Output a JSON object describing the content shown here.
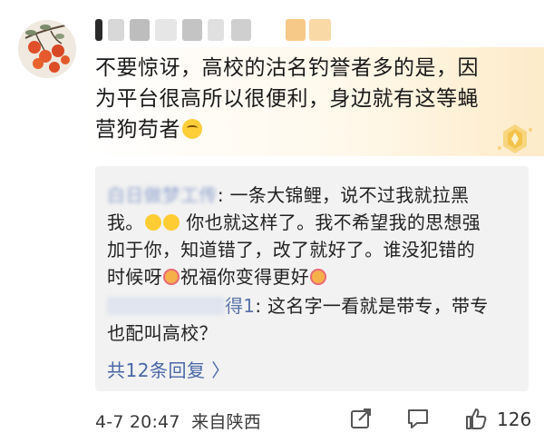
{
  "comment": {
    "text": "不要惊讶，高校的沽名钓誉者多的是，因为平台很高所以很便利，身边就有这等蝇营狗苟者"
  },
  "replies": [
    {
      "name": "白日做梦工传",
      "line1": ": 一条大锦鲤，说不过我就拉黑",
      "line2_prefix": "我。",
      "line2_suffix": "你也就这样了。我不希望我的思想强",
      "line3": "加于你，知道错了，改了就好了。谁没犯错的",
      "line4_prefix": "时候呀",
      "line4_mid": "祝福你变得更好"
    },
    {
      "name": "得1",
      "line1": ": 这名字一看就是带专，带专",
      "line2": "也配叫高校？"
    }
  ],
  "more_replies": "共12条回复 〉",
  "footer": {
    "time": "4-7 20:47",
    "location": "来自陕西",
    "like_count": "126"
  },
  "colors": {
    "link": "#4a67a5",
    "reply_bg": "#f2f2f2",
    "badge_gold": "#f4c34c"
  }
}
